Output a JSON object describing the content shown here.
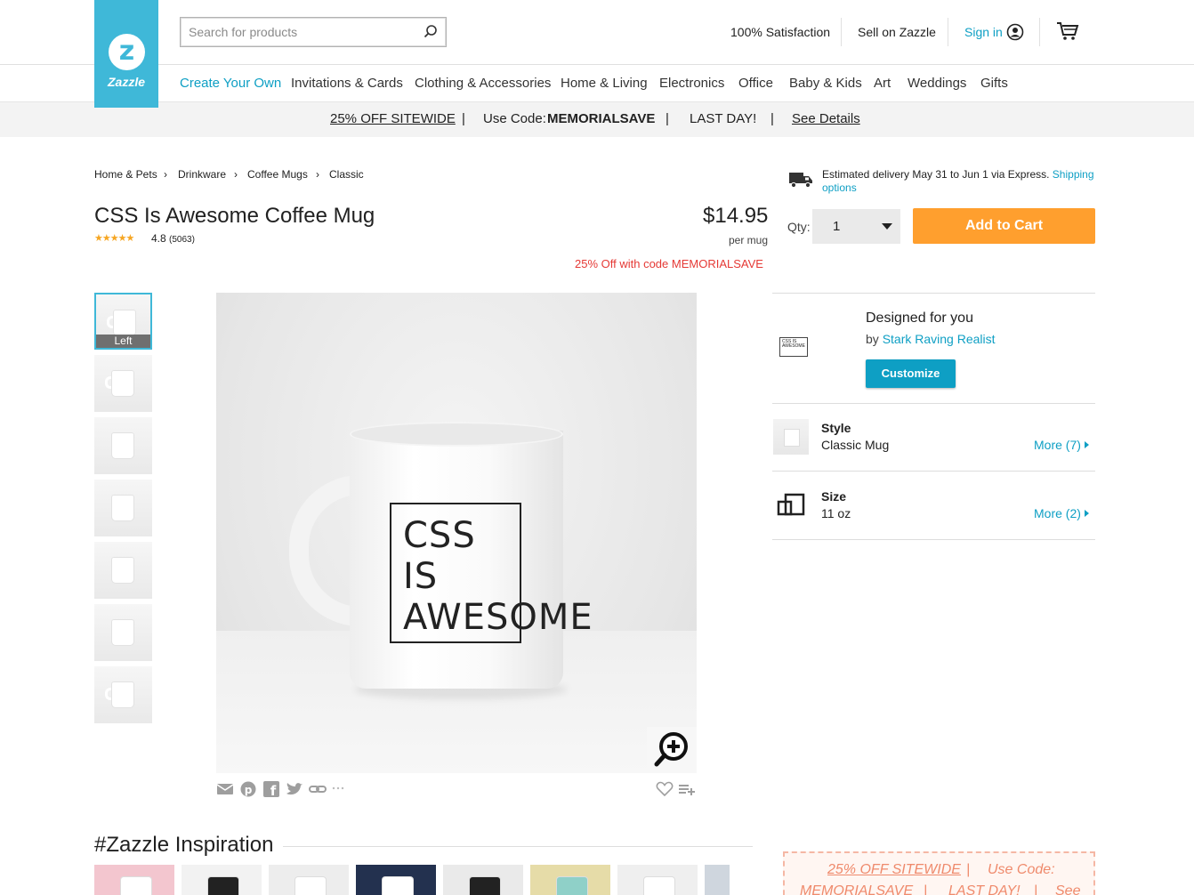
{
  "header": {
    "brand": "Zazzle",
    "search_placeholder": "Search for products",
    "links": {
      "satisfaction": "100% Satisfaction",
      "sell": "Sell on Zazzle",
      "signin": "Sign in"
    }
  },
  "nav": {
    "items": [
      "Create Your Own",
      "Invitations & Cards",
      "Clothing & Accessories",
      "Home & Living",
      "Electronics",
      "Office",
      "Baby & Kids",
      "Art",
      "Weddings",
      "Gifts"
    ]
  },
  "promo": {
    "offer": "25% OFF SITEWIDE",
    "sep": "|",
    "code_prefix": "Use Code:",
    "code": "MEMORIALSAVE",
    "last_day": "LAST DAY!",
    "details": "See Details"
  },
  "breadcrumb": [
    "Home & Pets",
    "Drinkware",
    "Coffee Mugs",
    "Classic"
  ],
  "breadcrumb_sep": "›",
  "product": {
    "title": "CSS Is Awesome Coffee Mug",
    "stars": "★★★★★",
    "rating": "4.8",
    "reviews": "(5063)",
    "price": "$14.95",
    "unit": "per mug",
    "discount": "25% Off with code MEMORIALSAVE",
    "thumb_active_label": "Left",
    "mug_text": "CSS\nIS\nAWESOME"
  },
  "purchase": {
    "delivery_text": "Estimated delivery May 31 to Jun 1 via Express.",
    "delivery_link": "Shipping options",
    "qty_label": "Qty:",
    "qty_value": "1",
    "add_to_cart": "Add to Cart"
  },
  "designer": {
    "heading": "Designed for you",
    "by_prefix": "by",
    "name": "Stark Raving Realist",
    "customize": "Customize",
    "thumb_text": "CSS IS AWESOME"
  },
  "options": {
    "style": {
      "label": "Style",
      "value": "Classic Mug",
      "more": "More (7)"
    },
    "size": {
      "label": "Size",
      "value": "11 oz",
      "more": "More (2)"
    }
  },
  "inspiration": {
    "title": "#Zazzle Inspiration"
  },
  "bottom_promo": {
    "offer": "25% OFF SITEWIDE",
    "sep": "|",
    "code_prefix": "Use Code:",
    "code": "MEMORIALSAVE",
    "last_day": "LAST DAY!",
    "see": "See"
  },
  "colors": {
    "brand": "#3fb8d8",
    "link": "#0e9fc4",
    "cta": "#ff9f2e",
    "discount": "#e53935"
  }
}
